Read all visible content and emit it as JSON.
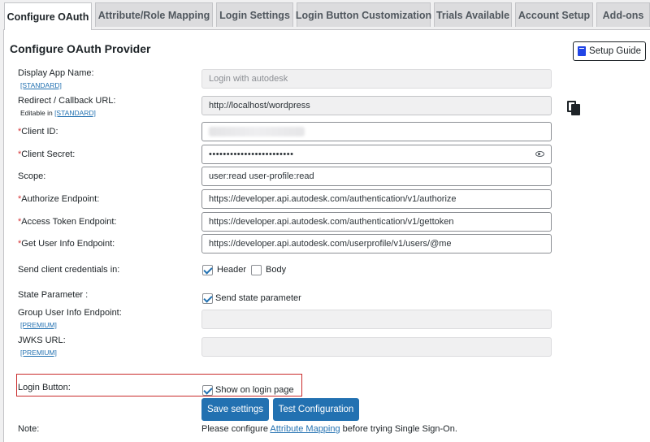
{
  "tabs": [
    {
      "label": "Configure OAuth",
      "active": true
    },
    {
      "label": "Attribute/Role Mapping"
    },
    {
      "label": "Login Settings"
    },
    {
      "label": "Login Button Customization"
    },
    {
      "label": "Trials Available"
    },
    {
      "label": "Account Setup"
    },
    {
      "label": "Add-ons"
    }
  ],
  "panel": {
    "title": "Configure OAuth Provider",
    "setup_guide_label": "Setup Guide"
  },
  "fields": {
    "display_app_name": {
      "label": "Display App Name:",
      "tag": "[STANDARD]",
      "value": "Login with autodesk"
    },
    "redirect_url": {
      "label": "Redirect / Callback URL:",
      "note_prefix": "Editable in ",
      "note_link": "[STANDARD]",
      "value": "http://localhost/wordpress"
    },
    "client_id": {
      "required": "*",
      "label": "Client ID:",
      "value": ""
    },
    "client_secret": {
      "required": "*",
      "label": "Client Secret:",
      "value": "••••••••••••••••••••••••"
    },
    "scope": {
      "label": "Scope:",
      "value": "user:read user-profile:read"
    },
    "authorize_endpoint": {
      "required": "*",
      "label": "Authorize Endpoint:",
      "value": "https://developer.api.autodesk.com/authentication/v1/authorize"
    },
    "access_token_endpoint": {
      "required": "*",
      "label": "Access Token Endpoint:",
      "value": "https://developer.api.autodesk.com/authentication/v1/gettoken"
    },
    "user_info_endpoint": {
      "required": "*",
      "label": "Get User Info Endpoint:",
      "value": "https://developer.api.autodesk.com/userprofile/v1/users/@me"
    },
    "send_credentials": {
      "label": "Send client credentials in:",
      "header_label": "Header",
      "header_checked": true,
      "body_label": "Body",
      "body_checked": false
    },
    "state_parameter": {
      "label": "State Parameter :",
      "option_label": "Send state parameter",
      "checked": true
    },
    "group_user_info": {
      "label": "Group User Info Endpoint:",
      "tag": "[PREMIUM]",
      "value": ""
    },
    "jwks_url": {
      "label": "JWKS URL:",
      "tag": "[PREMIUM]",
      "value": ""
    },
    "login_button": {
      "label": "Login Button:",
      "option_label": "Show on login page",
      "checked": true
    }
  },
  "actions": {
    "save_label": "Save settings",
    "test_label": "Test Configuration"
  },
  "note": {
    "label": "Note:",
    "prefix": "Please configure ",
    "link": "Attribute Mapping",
    "suffix": " before trying Single Sign-On."
  }
}
